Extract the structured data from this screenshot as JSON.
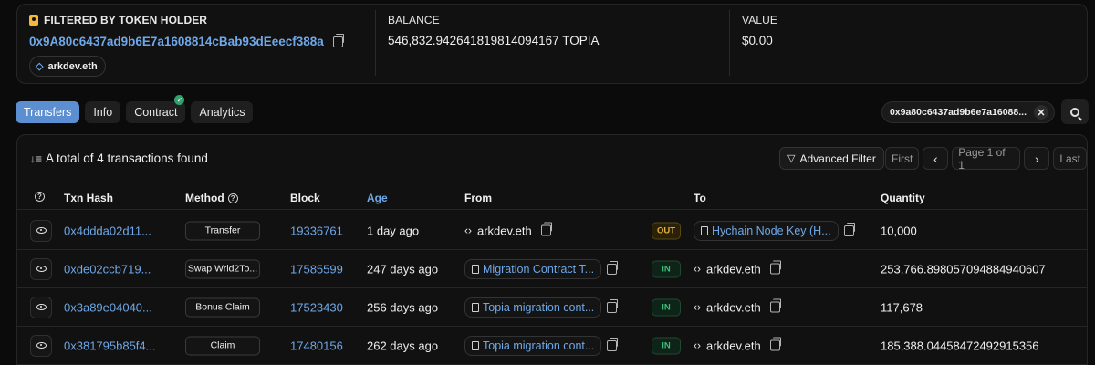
{
  "overview": {
    "holder_label": "FILTERED BY TOKEN HOLDER",
    "holder_address": "0x9A80c6437ad9b6E7a1608814cBab93dEeecf388a",
    "holder_ens": "arkdev.eth",
    "balance_label": "BALANCE",
    "balance_value": "546,832.942641819814094167 TOPIA",
    "value_label": "VALUE",
    "value_value": "$0.00"
  },
  "tabs": [
    {
      "label": "Transfers",
      "active": true
    },
    {
      "label": "Info",
      "active": false
    },
    {
      "label": "Contract",
      "active": false,
      "verified": true
    },
    {
      "label": "Analytics",
      "active": false
    }
  ],
  "filter_chip": {
    "text": "0x9a80c6437ad9b6e7a16088..."
  },
  "table": {
    "summary": "A total of 4 transactions found",
    "advanced_filter": "Advanced Filter",
    "pager": {
      "first": "First",
      "page": "Page 1 of 1",
      "last": "Last",
      "prev": "‹",
      "next": "›"
    },
    "headers": {
      "txn_hash": "Txn Hash",
      "method": "Method",
      "block": "Block",
      "age": "Age",
      "from": "From",
      "to": "To",
      "quantity": "Quantity"
    },
    "rows": [
      {
        "hash": "0x4ddda02d11...",
        "method": "Transfer",
        "block": "19336761",
        "age": "1 day ago",
        "from": "arkdev.eth",
        "dir": "OUT",
        "to": "Hychain Node Key (H...",
        "quantity": "10,000"
      },
      {
        "hash": "0xde02ccb719...",
        "method": "Swap Wrld2To...",
        "block": "17585599",
        "age": "247 days ago",
        "from": "Migration Contract T...",
        "dir": "IN",
        "to": "arkdev.eth",
        "quantity": "253,766.898057094884940607"
      },
      {
        "hash": "0x3a89e04040...",
        "method": "Bonus Claim",
        "block": "17523430",
        "age": "256 days ago",
        "from": "Topia migration cont...",
        "dir": "IN",
        "to": "arkdev.eth",
        "quantity": "117,678"
      },
      {
        "hash": "0x381795b85f4...",
        "method": "Claim",
        "block": "17480156",
        "age": "262 days ago",
        "from": "Topia migration cont...",
        "dir": "IN",
        "to": "arkdev.eth",
        "quantity": "185,388.04458472492915356"
      }
    ]
  },
  "colors": {
    "accent": "#5b8fd1",
    "link": "#6ea8e8",
    "in": "#3dbb7a",
    "out": "#e0b040"
  }
}
